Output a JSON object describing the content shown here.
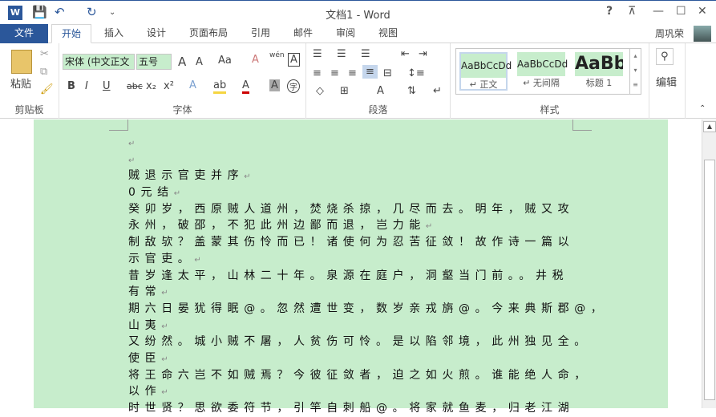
{
  "titlebar": {
    "title": "文档1 - Word",
    "help": "?",
    "restore_ribbon": "⊼",
    "minimize": "—",
    "maximize": "☐",
    "close": "✕",
    "qa_undo": "↶",
    "qa_redo": "↻",
    "qa_customize": "⌄",
    "app_icon": "W"
  },
  "tabs": [
    "文件",
    "开始",
    "插入",
    "设计",
    "页面布局",
    "引用",
    "邮件",
    "审阅",
    "视图"
  ],
  "user": "周巩荣",
  "ribbon": {
    "clipboard": {
      "label": "剪贴板",
      "paste": "粘贴"
    },
    "font": {
      "label": "字体",
      "font_name": "宋体 (中文正文",
      "font_size": "五号",
      "grow": "A",
      "shrink": "A",
      "case": "Aa",
      "bold": "B",
      "italic": "I",
      "underline": "U",
      "strike": "abc",
      "sub": "x₂",
      "sup": "x²",
      "phonetic": "wén",
      "enclose": "字"
    },
    "paragraph": {
      "label": "段落"
    },
    "styles": {
      "label": "样式",
      "items": [
        {
          "preview": "AaBbCcDd",
          "name": "↵ 正文"
        },
        {
          "preview": "AaBbCcDd",
          "name": "↵ 无间隔"
        },
        {
          "preview": "AaBb",
          "name": "标题 1"
        }
      ]
    },
    "editing": {
      "label": "编辑"
    }
  },
  "document": {
    "lines": [
      {
        "t": "",
        "pm": true
      },
      {
        "t": "",
        "pm": true
      },
      {
        "t": "贼退示官吏并序",
        "pm": true
      },
      {
        "t": "0元结",
        "pm": true
      },
      {
        "t": "癸卯岁，西原贼人道州，焚烧杀掠，几尽而去。明年，贼又攻",
        "pm": false
      },
      {
        "t": "永州，破邵，不犯此州边鄙而退，岂力能",
        "pm": true
      },
      {
        "t": "制敌欤？盖蒙其伤怜而已！诸使何为忍苦征敛！故作诗一篇以",
        "pm": false
      },
      {
        "t": "示官吏。",
        "pm": true
      },
      {
        "t": "昔岁逢太平，山林二十年。泉源在庭户，洞壑当门前。。井税",
        "pm": false
      },
      {
        "t": "有常",
        "pm": true
      },
      {
        "t": "期六日晏犹得眠@。忽然遭世变，数岁亲戎旃@。今来典斯郡@，",
        "pm": false
      },
      {
        "t": "山夷",
        "pm": true
      },
      {
        "t": "又纷然。城小贼不屠，人贫伤可怜。是以陷邻境，此州独见全。",
        "pm": false
      },
      {
        "t": "使臣",
        "pm": true
      },
      {
        "t": "将王命六岂不如贼焉？今彼征敛者，迫之如火煎。谁能绝人命，",
        "pm": false
      },
      {
        "t": "以作",
        "pm": true
      },
      {
        "t": "时世贤？思欲委符节，引竿自刺船@。将家就鱼麦，归老江湖",
        "pm": false
      }
    ],
    "pilcrow": "↵"
  }
}
